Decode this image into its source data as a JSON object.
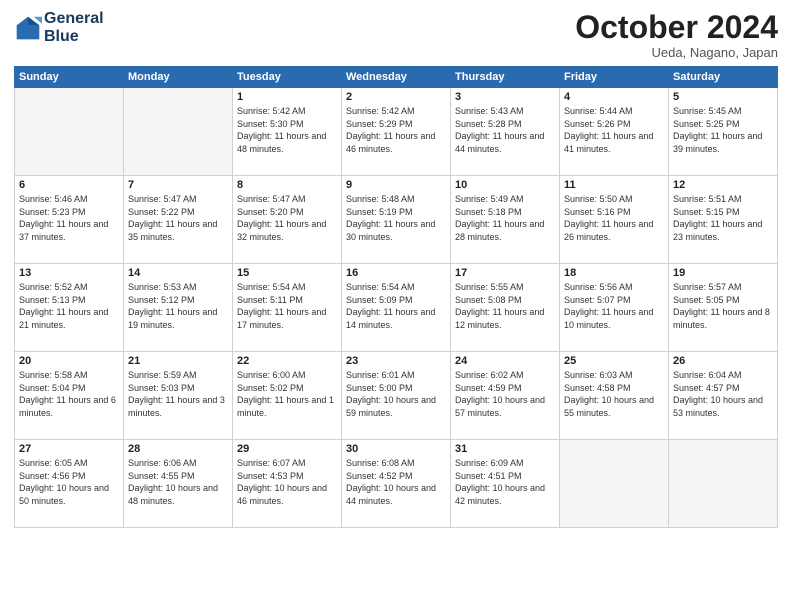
{
  "header": {
    "logo_line1": "General",
    "logo_line2": "Blue",
    "month": "October 2024",
    "location": "Ueda, Nagano, Japan"
  },
  "weekdays": [
    "Sunday",
    "Monday",
    "Tuesday",
    "Wednesday",
    "Thursday",
    "Friday",
    "Saturday"
  ],
  "weeks": [
    [
      {
        "day": "",
        "sunrise": "",
        "sunset": "",
        "daylight": ""
      },
      {
        "day": "",
        "sunrise": "",
        "sunset": "",
        "daylight": ""
      },
      {
        "day": "1",
        "sunrise": "Sunrise: 5:42 AM",
        "sunset": "Sunset: 5:30 PM",
        "daylight": "Daylight: 11 hours and 48 minutes."
      },
      {
        "day": "2",
        "sunrise": "Sunrise: 5:42 AM",
        "sunset": "Sunset: 5:29 PM",
        "daylight": "Daylight: 11 hours and 46 minutes."
      },
      {
        "day": "3",
        "sunrise": "Sunrise: 5:43 AM",
        "sunset": "Sunset: 5:28 PM",
        "daylight": "Daylight: 11 hours and 44 minutes."
      },
      {
        "day": "4",
        "sunrise": "Sunrise: 5:44 AM",
        "sunset": "Sunset: 5:26 PM",
        "daylight": "Daylight: 11 hours and 41 minutes."
      },
      {
        "day": "5",
        "sunrise": "Sunrise: 5:45 AM",
        "sunset": "Sunset: 5:25 PM",
        "daylight": "Daylight: 11 hours and 39 minutes."
      }
    ],
    [
      {
        "day": "6",
        "sunrise": "Sunrise: 5:46 AM",
        "sunset": "Sunset: 5:23 PM",
        "daylight": "Daylight: 11 hours and 37 minutes."
      },
      {
        "day": "7",
        "sunrise": "Sunrise: 5:47 AM",
        "sunset": "Sunset: 5:22 PM",
        "daylight": "Daylight: 11 hours and 35 minutes."
      },
      {
        "day": "8",
        "sunrise": "Sunrise: 5:47 AM",
        "sunset": "Sunset: 5:20 PM",
        "daylight": "Daylight: 11 hours and 32 minutes."
      },
      {
        "day": "9",
        "sunrise": "Sunrise: 5:48 AM",
        "sunset": "Sunset: 5:19 PM",
        "daylight": "Daylight: 11 hours and 30 minutes."
      },
      {
        "day": "10",
        "sunrise": "Sunrise: 5:49 AM",
        "sunset": "Sunset: 5:18 PM",
        "daylight": "Daylight: 11 hours and 28 minutes."
      },
      {
        "day": "11",
        "sunrise": "Sunrise: 5:50 AM",
        "sunset": "Sunset: 5:16 PM",
        "daylight": "Daylight: 11 hours and 26 minutes."
      },
      {
        "day": "12",
        "sunrise": "Sunrise: 5:51 AM",
        "sunset": "Sunset: 5:15 PM",
        "daylight": "Daylight: 11 hours and 23 minutes."
      }
    ],
    [
      {
        "day": "13",
        "sunrise": "Sunrise: 5:52 AM",
        "sunset": "Sunset: 5:13 PM",
        "daylight": "Daylight: 11 hours and 21 minutes."
      },
      {
        "day": "14",
        "sunrise": "Sunrise: 5:53 AM",
        "sunset": "Sunset: 5:12 PM",
        "daylight": "Daylight: 11 hours and 19 minutes."
      },
      {
        "day": "15",
        "sunrise": "Sunrise: 5:54 AM",
        "sunset": "Sunset: 5:11 PM",
        "daylight": "Daylight: 11 hours and 17 minutes."
      },
      {
        "day": "16",
        "sunrise": "Sunrise: 5:54 AM",
        "sunset": "Sunset: 5:09 PM",
        "daylight": "Daylight: 11 hours and 14 minutes."
      },
      {
        "day": "17",
        "sunrise": "Sunrise: 5:55 AM",
        "sunset": "Sunset: 5:08 PM",
        "daylight": "Daylight: 11 hours and 12 minutes."
      },
      {
        "day": "18",
        "sunrise": "Sunrise: 5:56 AM",
        "sunset": "Sunset: 5:07 PM",
        "daylight": "Daylight: 11 hours and 10 minutes."
      },
      {
        "day": "19",
        "sunrise": "Sunrise: 5:57 AM",
        "sunset": "Sunset: 5:05 PM",
        "daylight": "Daylight: 11 hours and 8 minutes."
      }
    ],
    [
      {
        "day": "20",
        "sunrise": "Sunrise: 5:58 AM",
        "sunset": "Sunset: 5:04 PM",
        "daylight": "Daylight: 11 hours and 6 minutes."
      },
      {
        "day": "21",
        "sunrise": "Sunrise: 5:59 AM",
        "sunset": "Sunset: 5:03 PM",
        "daylight": "Daylight: 11 hours and 3 minutes."
      },
      {
        "day": "22",
        "sunrise": "Sunrise: 6:00 AM",
        "sunset": "Sunset: 5:02 PM",
        "daylight": "Daylight: 11 hours and 1 minute."
      },
      {
        "day": "23",
        "sunrise": "Sunrise: 6:01 AM",
        "sunset": "Sunset: 5:00 PM",
        "daylight": "Daylight: 10 hours and 59 minutes."
      },
      {
        "day": "24",
        "sunrise": "Sunrise: 6:02 AM",
        "sunset": "Sunset: 4:59 PM",
        "daylight": "Daylight: 10 hours and 57 minutes."
      },
      {
        "day": "25",
        "sunrise": "Sunrise: 6:03 AM",
        "sunset": "Sunset: 4:58 PM",
        "daylight": "Daylight: 10 hours and 55 minutes."
      },
      {
        "day": "26",
        "sunrise": "Sunrise: 6:04 AM",
        "sunset": "Sunset: 4:57 PM",
        "daylight": "Daylight: 10 hours and 53 minutes."
      }
    ],
    [
      {
        "day": "27",
        "sunrise": "Sunrise: 6:05 AM",
        "sunset": "Sunset: 4:56 PM",
        "daylight": "Daylight: 10 hours and 50 minutes."
      },
      {
        "day": "28",
        "sunrise": "Sunrise: 6:06 AM",
        "sunset": "Sunset: 4:55 PM",
        "daylight": "Daylight: 10 hours and 48 minutes."
      },
      {
        "day": "29",
        "sunrise": "Sunrise: 6:07 AM",
        "sunset": "Sunset: 4:53 PM",
        "daylight": "Daylight: 10 hours and 46 minutes."
      },
      {
        "day": "30",
        "sunrise": "Sunrise: 6:08 AM",
        "sunset": "Sunset: 4:52 PM",
        "daylight": "Daylight: 10 hours and 44 minutes."
      },
      {
        "day": "31",
        "sunrise": "Sunrise: 6:09 AM",
        "sunset": "Sunset: 4:51 PM",
        "daylight": "Daylight: 10 hours and 42 minutes."
      },
      {
        "day": "",
        "sunrise": "",
        "sunset": "",
        "daylight": ""
      },
      {
        "day": "",
        "sunrise": "",
        "sunset": "",
        "daylight": ""
      }
    ]
  ]
}
